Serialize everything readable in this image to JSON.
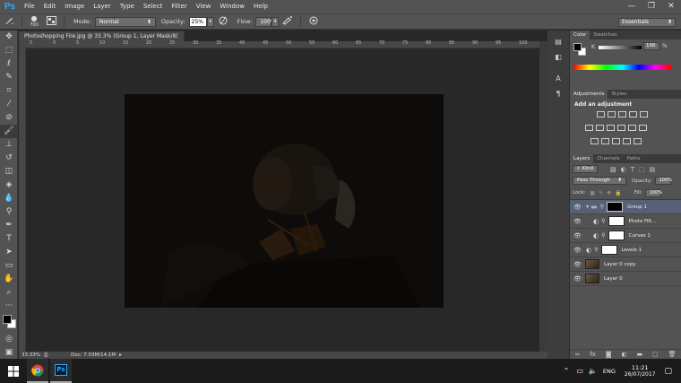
{
  "menubar": {
    "logo": "Ps",
    "items": [
      "File",
      "Edit",
      "Image",
      "Layer",
      "Type",
      "Select",
      "Filter",
      "View",
      "Window",
      "Help"
    ],
    "win_minimize": "—",
    "win_restore": "❐",
    "win_close": "✕"
  },
  "options": {
    "brush_size": "700",
    "mode_label": "Mode:",
    "mode_value": "Normal",
    "opacity_label": "Opacity:",
    "opacity_value": "25%",
    "flow_label": "Flow:",
    "flow_value": "100%",
    "workspace": "Essentials"
  },
  "document": {
    "tab_title": "Photoshopping Fire.jpg @ 33.3% (Group 1, Layer Mask/8) *",
    "tab_close": "×",
    "zoom": "33.33%",
    "doc_info": "Doc: 7.03M/14.1M",
    "ruler_numbers": [
      "5",
      "0",
      "5",
      "10",
      "15",
      "20",
      "25",
      "30",
      "35",
      "40",
      "45",
      "50",
      "55",
      "60",
      "65",
      "70",
      "75",
      "80",
      "85",
      "90",
      "95",
      "100"
    ]
  },
  "color_panel": {
    "tabs": [
      "Color",
      "Swatches"
    ],
    "k_label": "K",
    "k_value": "100",
    "k_unit": "%"
  },
  "adjustments_panel": {
    "tabs": [
      "Adjustments",
      "Styles"
    ],
    "heading": "Add an adjustment"
  },
  "layers_panel": {
    "tabs": [
      "Layers",
      "Channels",
      "Paths"
    ],
    "kind_label": "Kind",
    "blend_mode": "Pass Through",
    "opacity_label": "Opacity:",
    "opacity_value": "100%",
    "lock_label": "Lock:",
    "fill_label": "Fill:",
    "fill_value": "100%",
    "layers": [
      {
        "name": "Group 1",
        "type": "group",
        "selected": true
      },
      {
        "name": "Photo Filt...",
        "type": "adjustment",
        "selected": false
      },
      {
        "name": "Curves 1",
        "type": "adjustment",
        "selected": false
      },
      {
        "name": "Levels 1",
        "type": "adjustment",
        "selected": false
      },
      {
        "name": "Layer 0 copy",
        "type": "image",
        "selected": false
      },
      {
        "name": "Layer 0",
        "type": "image",
        "selected": false
      }
    ]
  },
  "taskbar": {
    "lang": "ENG",
    "time": "11:21",
    "date": "26/07/2017"
  },
  "colors": {
    "ps_blue": "#31a8ff",
    "selected_layer": "#566076",
    "ui_gray": "#535353"
  }
}
